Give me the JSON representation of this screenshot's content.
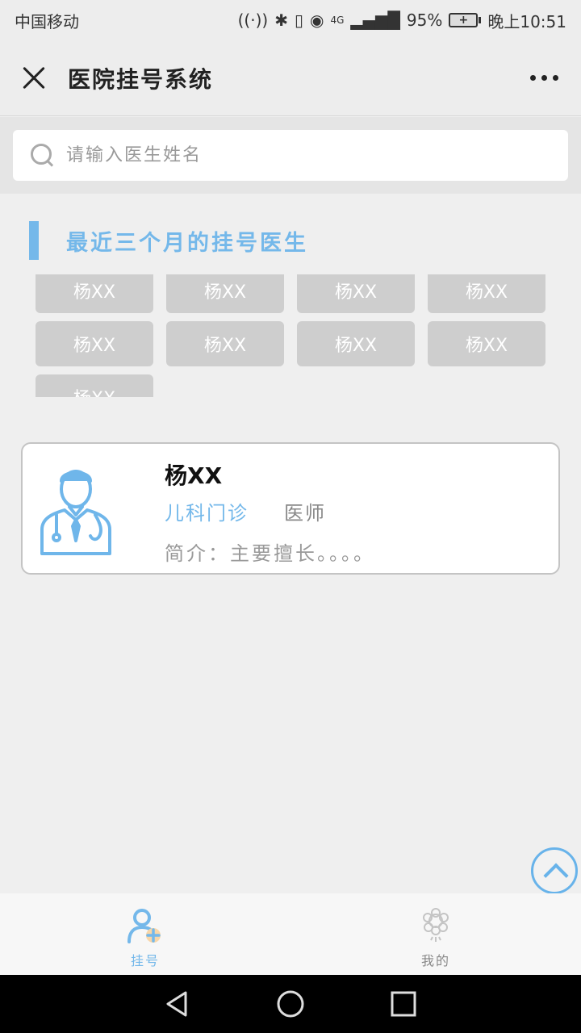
{
  "status_bar": {
    "carrier": "中国移动",
    "network": "4G",
    "battery_percent": "95%",
    "time": "晚上10:51"
  },
  "nav": {
    "title": "医院挂号系统"
  },
  "search": {
    "placeholder": "请输入医生姓名",
    "value": ""
  },
  "recent": {
    "title": "最近三个月的挂号医生",
    "doctors": [
      "杨XX",
      "杨XX",
      "杨XX",
      "杨XX",
      "杨XX",
      "杨XX",
      "杨XX",
      "杨XX",
      "杨XX"
    ]
  },
  "doctor_card": {
    "name": "杨XX",
    "department": "儿科门诊",
    "title": "医师",
    "intro": "简介：主要擅长。。。。"
  },
  "tabs": [
    {
      "label": "挂号",
      "icon": "register-icon",
      "active": true
    },
    {
      "label": "我的",
      "icon": "profile-icon",
      "active": false
    }
  ],
  "colors": {
    "accent": "#74b8ea",
    "chip": "#cecece",
    "inactive": "#b8b8b8"
  }
}
